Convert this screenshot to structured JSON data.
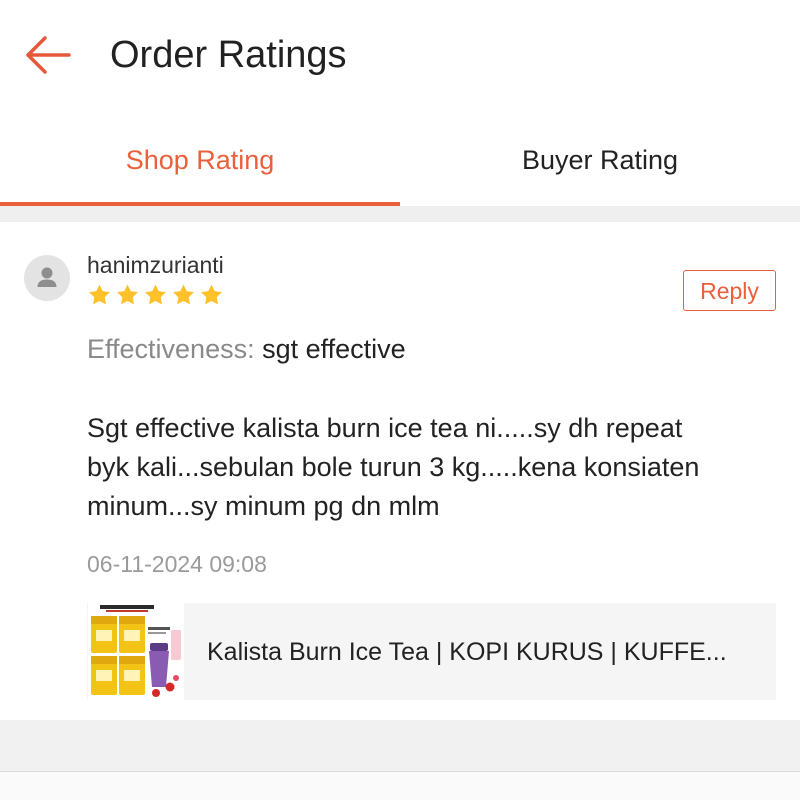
{
  "header": {
    "title": "Order Ratings",
    "back_icon": "arrow-left-icon"
  },
  "tabs": [
    {
      "label": "Shop Rating",
      "active": true
    },
    {
      "label": "Buyer Rating",
      "active": false
    }
  ],
  "review": {
    "avatar_icon": "person-icon",
    "username": "hanimzurianti",
    "rating": 5,
    "rating_max": 5,
    "star_icon": "star-icon",
    "reply_label": "Reply",
    "attribute_label": "Effectiveness:",
    "attribute_value": "sgt effective",
    "text_lines": [
      "Sgt effective kalista burn ice tea ni.....sy dh repeat",
      "byk kali...sebulan bole turun 3 kg.....kena konsiaten",
      "minum...sy minum pg dn mlm"
    ],
    "timestamp": "06-11-2024 09:08",
    "product": {
      "name": "Kalista Burn Ice Tea | KOPI KURUS | KUFFE..."
    }
  },
  "colors": {
    "accent": "#E9603B",
    "star": "#FFC12B",
    "divider": "#EFEFEF"
  }
}
